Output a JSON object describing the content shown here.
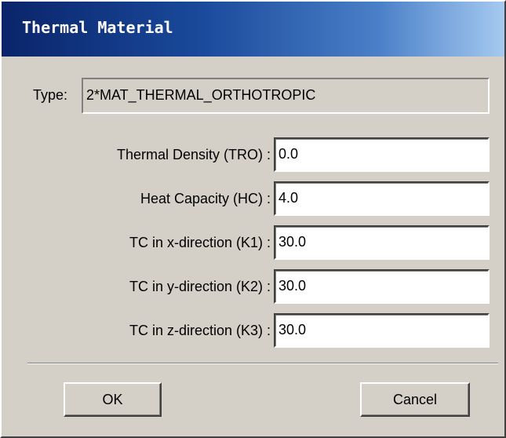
{
  "window": {
    "title": "Thermal Material"
  },
  "type": {
    "label": "Type:",
    "value": "2*MAT_THERMAL_ORTHOTROPIC"
  },
  "fields": [
    {
      "label": "Thermal Density (TRO) :",
      "value": "0.0"
    },
    {
      "label": "Heat Capacity (HC) :",
      "value": "4.0"
    },
    {
      "label": "TC in x-direction  (K1) :",
      "value": "30.0"
    },
    {
      "label": "TC in y-direction  (K2) :",
      "value": "30.0"
    },
    {
      "label": "TC in z-direction  (K3) :",
      "value": "30.0"
    }
  ],
  "buttons": {
    "ok": "OK",
    "cancel": "Cancel"
  },
  "colors": {
    "titlebar_start": "#0a246a",
    "titlebar_end": "#a6caf0",
    "face": "#d4d0c8"
  }
}
